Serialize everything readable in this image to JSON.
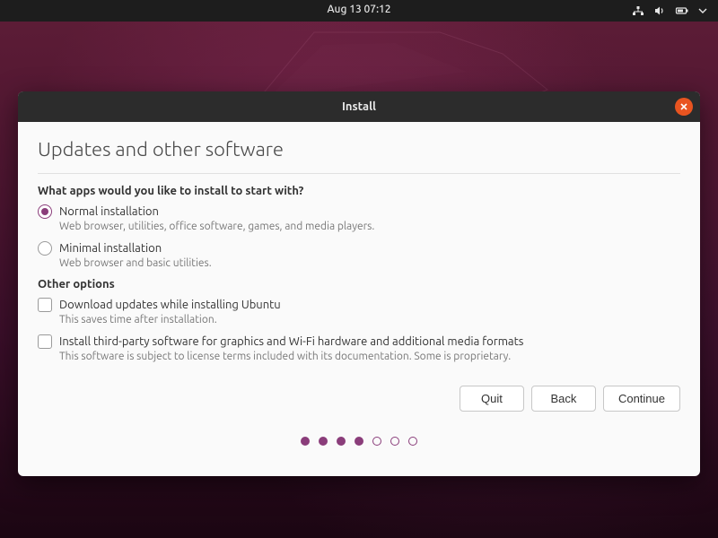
{
  "topbar": {
    "datetime": "Aug 13  07:12"
  },
  "window": {
    "title": "Install"
  },
  "page": {
    "heading": "Updates and other software",
    "question": "What apps would you like to install to start with?",
    "normal": {
      "label": "Normal installation",
      "desc": "Web browser, utilities, office software, games, and media players."
    },
    "minimal": {
      "label": "Minimal installation",
      "desc": "Web browser and basic utilities."
    },
    "other_heading": "Other options",
    "updates": {
      "label": "Download updates while installing Ubuntu",
      "desc": "This saves time after installation."
    },
    "thirdparty": {
      "label": "Install third-party software for graphics and Wi-Fi hardware and additional media formats",
      "desc": "This software is subject to license terms included with its documentation. Some is proprietary."
    }
  },
  "buttons": {
    "quit": "Quit",
    "back": "Back",
    "continue": "Continue"
  },
  "progress": {
    "current": 4,
    "total": 7
  },
  "colors": {
    "accent": "#8a3d7a",
    "close": "#e95420"
  }
}
